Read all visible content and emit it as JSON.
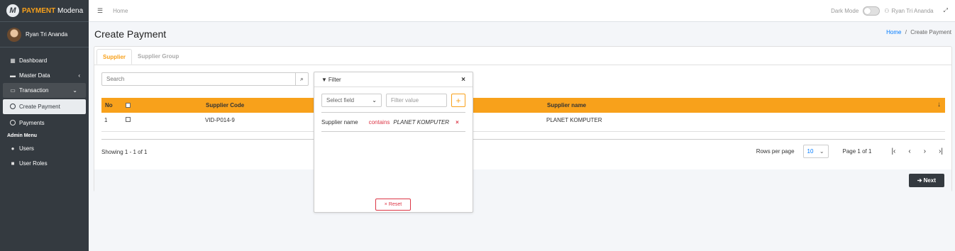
{
  "brand": {
    "bold": "PAYMENT",
    "rest": " Modena",
    "logo_letter": "M"
  },
  "user": {
    "name": "Ryan Tri Ananda"
  },
  "sidebar": {
    "items": [
      {
        "label": "Dashboard",
        "icon": "table-icon"
      },
      {
        "label": "Master Data",
        "icon": "truck-icon"
      },
      {
        "label": "Transaction",
        "icon": "card-icon"
      },
      {
        "label": "Create Payment",
        "icon": "circle-icon"
      },
      {
        "label": "Payments",
        "icon": "circle-icon"
      }
    ],
    "admin_header": "Admin Menu",
    "admin_items": [
      {
        "label": "Users",
        "icon": "users-icon"
      },
      {
        "label": "User Roles",
        "icon": "lock-icon"
      }
    ]
  },
  "topbar": {
    "home": "Home",
    "dark_mode": "Dark Mode",
    "user": "Ryan Tri Ananda"
  },
  "page": {
    "title": "Create Payment",
    "crumb_home": "Home",
    "crumb_sep": "/",
    "crumb_current": "Create Payment"
  },
  "tabs": [
    "Supplier",
    "Supplier Group"
  ],
  "search": {
    "placeholder": "Search"
  },
  "table": {
    "headers": [
      "No",
      "Supplier Code",
      "Supplier name"
    ],
    "rows": [
      {
        "no": "1",
        "code": "VID-P014-9",
        "name": "PLANET KOMPUTER"
      }
    ]
  },
  "pagination": {
    "showing": "Showing 1 - 1 of 1",
    "rows_label": "Rows per page",
    "rows_value": "10",
    "page_info": "Page 1 of 1"
  },
  "next_label": "Next",
  "filter": {
    "title": "Filter",
    "select_placeholder": "Select field",
    "value_placeholder": "Filter value",
    "condition": {
      "field": "Supplier name",
      "op": "contains",
      "value": "PLANET KOMPUTER"
    },
    "reset_label": "Reset"
  },
  "colors": {
    "accent": "#f8a11b",
    "sidebar": "#343a40",
    "danger": "#dc3545"
  }
}
